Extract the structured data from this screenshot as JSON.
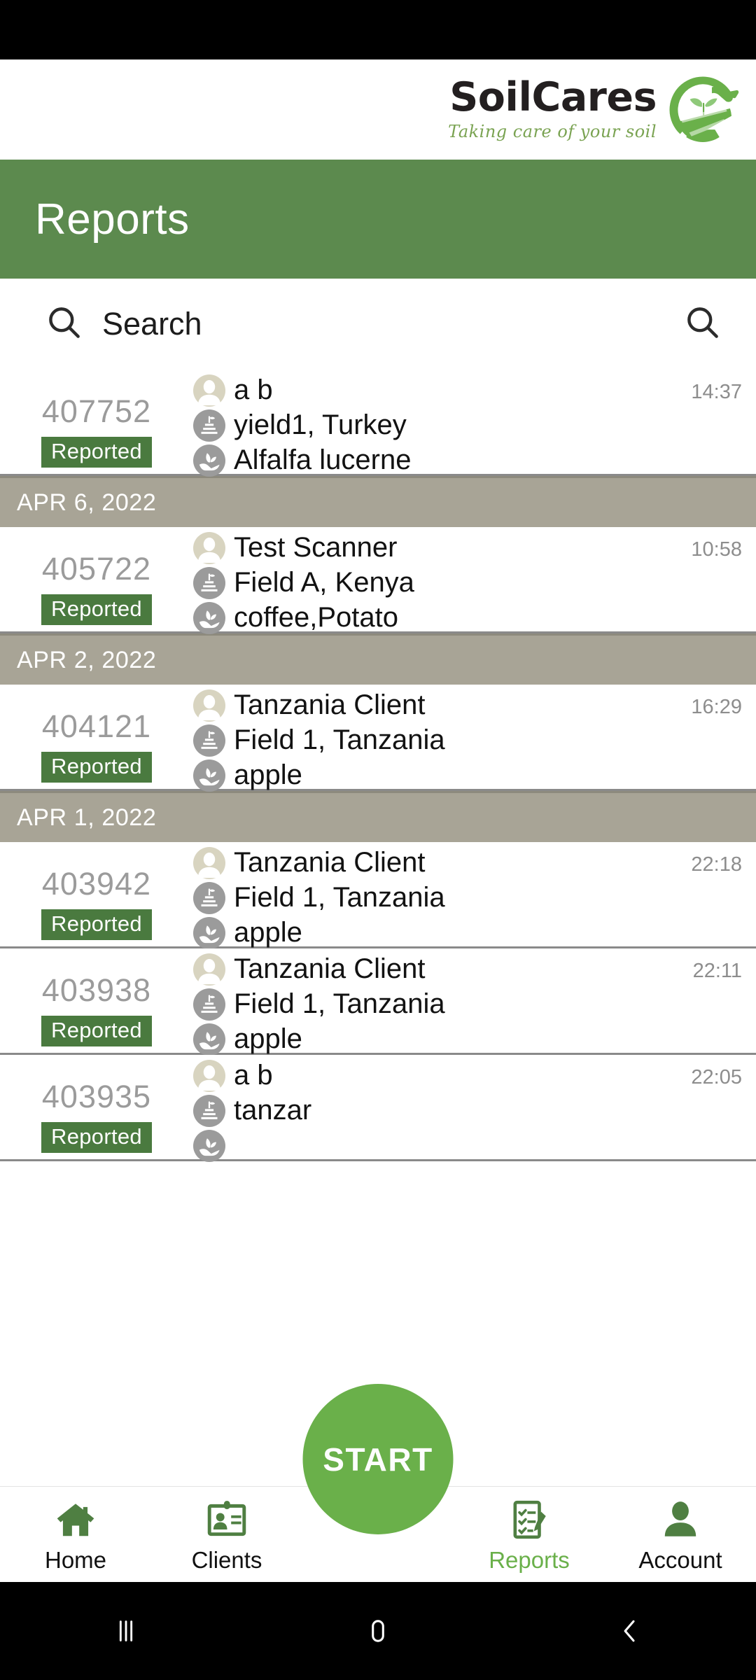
{
  "brand": {
    "name": "SoilCares",
    "tagline": "Taking care of your soil",
    "logo_icon": "soilcares-hand-sprout-logo",
    "logo_color": "#6ab04a",
    "name_color": "#231f20"
  },
  "header": {
    "title": "Reports",
    "background_color": "#5c8a4e",
    "text_color": "#ffffff"
  },
  "search": {
    "placeholder": "Search",
    "left_icon": "search-icon",
    "right_icon": "search-icon"
  },
  "colors": {
    "accent_green": "#6ab04a",
    "header_green": "#5c8a4e",
    "badge_green": "#4a7a3f",
    "date_separator": "#a8a496",
    "id_gray": "#9b9b9b",
    "time_gray": "#8d8d8d"
  },
  "list": [
    {
      "type": "report",
      "id": "407752",
      "status": "Reported",
      "client": "a b",
      "field": "yield1, Turkey",
      "crop": "Alfalfa lucerne",
      "time": "14:37"
    },
    {
      "type": "date",
      "label": "APR 6, 2022"
    },
    {
      "type": "report",
      "id": "405722",
      "status": "Reported",
      "client": "Test Scanner",
      "field": "Field A, Kenya",
      "crop": "coffee,Potato",
      "time": "10:58"
    },
    {
      "type": "date",
      "label": "APR 2, 2022"
    },
    {
      "type": "report",
      "id": "404121",
      "status": "Reported",
      "client": "Tanzania Client",
      "field": "Field 1, Tanzania",
      "crop": "apple",
      "time": "16:29"
    },
    {
      "type": "date",
      "label": "APR 1, 2022"
    },
    {
      "type": "report",
      "id": "403942",
      "status": "Reported",
      "client": "Tanzania Client",
      "field": "Field 1, Tanzania",
      "crop": "apple",
      "time": "22:18"
    },
    {
      "type": "report",
      "id": "403938",
      "status": "Reported",
      "client": "Tanzania Client",
      "field": "Field 1, Tanzania",
      "crop": "apple",
      "time": "22:11"
    },
    {
      "type": "report",
      "id": "403935",
      "status": "Reported",
      "client": "a b",
      "field": "tanzar",
      "crop": "",
      "time": "22:05"
    }
  ],
  "fab": {
    "label": "START",
    "color": "#6ab04a"
  },
  "bottom_nav": {
    "items": [
      {
        "label": "Home",
        "icon": "home-icon",
        "active": false
      },
      {
        "label": "Clients",
        "icon": "id-card-icon",
        "active": false
      },
      {
        "label": "Reports",
        "icon": "clipboard-pencil-icon",
        "active": true
      },
      {
        "label": "Account",
        "icon": "person-icon",
        "active": false
      }
    ]
  },
  "android_nav": {
    "recent_label": "recent-apps",
    "home_label": "home",
    "back_label": "back"
  }
}
